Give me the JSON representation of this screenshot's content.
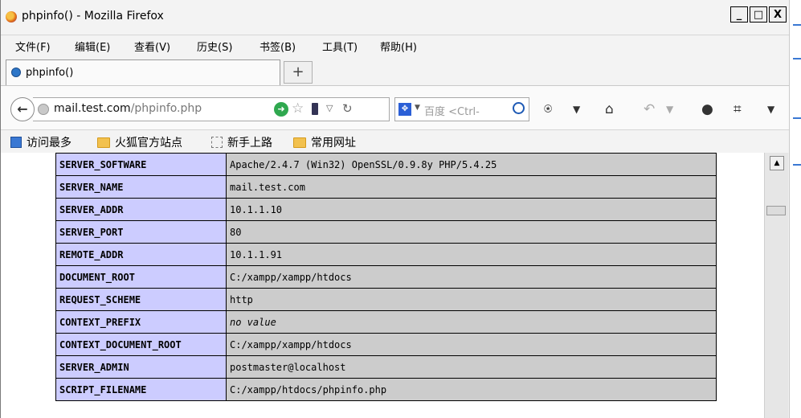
{
  "window": {
    "title": "phpinfo() - Mozilla Firefox",
    "controls": {
      "minimize": "_",
      "maximize": "□",
      "close": "X"
    }
  },
  "menu": [
    {
      "label": "文件(F)"
    },
    {
      "label": "编辑(E)"
    },
    {
      "label": "查看(V)"
    },
    {
      "label": "历史(S)"
    },
    {
      "label": "书签(B)"
    },
    {
      "label": "工具(T)"
    },
    {
      "label": "帮助(H)"
    }
  ],
  "tabs": [
    {
      "label": "phpinfo()"
    }
  ],
  "new_tab_label": "+",
  "url": {
    "domain": "mail.test.com",
    "path": "/phpinfo.php"
  },
  "search": {
    "placeholder": "百度 <Ctrl-"
  },
  "bookmarks": [
    {
      "label": "访问最多",
      "icon": "most-visited-icon"
    },
    {
      "label": "火狐官方站点",
      "icon": "folder-icon"
    },
    {
      "label": "新手上路",
      "icon": "folder-icon"
    },
    {
      "label": "常用网址",
      "icon": "folder-icon"
    }
  ],
  "table": {
    "rows": [
      {
        "key": "SERVER_SOFTWARE",
        "value": "Apache/2.4.7 (Win32) OpenSSL/0.9.8y PHP/5.4.25"
      },
      {
        "key": "SERVER_NAME",
        "value": "mail.test.com"
      },
      {
        "key": "SERVER_ADDR",
        "value": "10.1.1.10"
      },
      {
        "key": "SERVER_PORT",
        "value": "80"
      },
      {
        "key": "REMOTE_ADDR",
        "value": "10.1.1.91"
      },
      {
        "key": "DOCUMENT_ROOT",
        "value": "C:/xampp/xampp/htdocs"
      },
      {
        "key": "REQUEST_SCHEME",
        "value": "http"
      },
      {
        "key": "CONTEXT_PREFIX",
        "value": "no value"
      },
      {
        "key": "CONTEXT_DOCUMENT_ROOT",
        "value": "C:/xampp/xampp/htdocs"
      },
      {
        "key": "SERVER_ADMIN",
        "value": "postmaster@localhost"
      },
      {
        "key": "SCRIPT_FILENAME",
        "value": "C:/xampp/htdocs/phpinfo.php"
      }
    ]
  },
  "colors": {
    "key_cell": "#ccccff",
    "value_cell": "#cccccc",
    "firefox_accent": "#e06a15"
  }
}
